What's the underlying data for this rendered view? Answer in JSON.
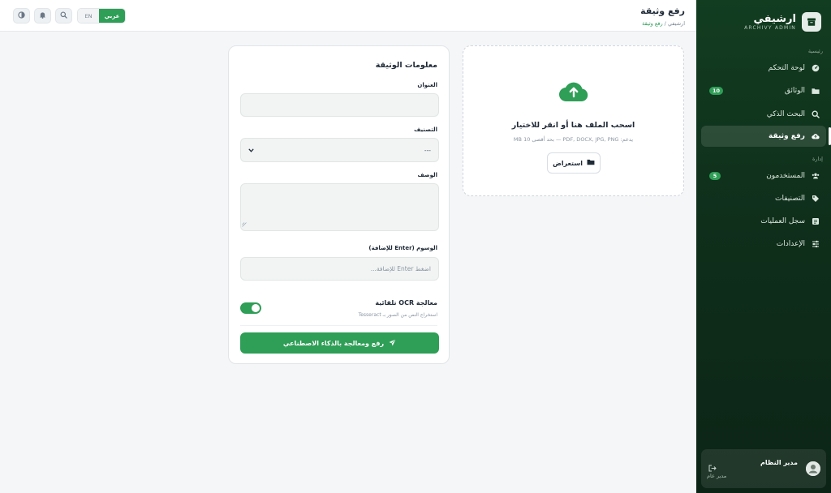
{
  "brand": {
    "name": "ارشيفي",
    "subtitle": "ARCHIVY ADMIN"
  },
  "sidebar": {
    "sections": [
      {
        "label": "رئيسية"
      },
      {
        "label": "إدارة"
      }
    ],
    "items": [
      {
        "label": "لوحة التحكم",
        "icon": "dashboard-icon"
      },
      {
        "label": "الوثائق",
        "icon": "folder-icon",
        "badge": "10"
      },
      {
        "label": "البحث الذكي",
        "icon": "search-icon"
      },
      {
        "label": "رفع وثيقة",
        "icon": "cloud-upload-icon",
        "active": true
      },
      {
        "label": "المستخدمون",
        "icon": "users-icon",
        "badge": "5"
      },
      {
        "label": "التصنيفات",
        "icon": "tags-icon"
      },
      {
        "label": "سجل العمليات",
        "icon": "history-icon"
      },
      {
        "label": "الإعدادات",
        "icon": "sliders-icon"
      }
    ]
  },
  "user": {
    "name": "مدير النظام",
    "role": "مدير عام"
  },
  "topbar": {
    "title": "رفع وثيقة",
    "breadcrumb_home": "ارشيفي",
    "breadcrumb_sep": " / ",
    "breadcrumb_current": "رفع وثيقة",
    "lang_en": "EN",
    "lang_ar": "عربي"
  },
  "upload": {
    "title": "اسحب الملف هنا أو انقر للاختيار",
    "hint": "يدعم: PDF, DOCX, JPG, PNG — بحد أقصى 10 MB",
    "browse_label": "استعراض"
  },
  "form": {
    "title": "معلومات الوثيقة",
    "title_label": "العنوان",
    "title_value": "",
    "category_label": "التصنيف",
    "category_value": "---",
    "description_label": "الوصف",
    "description_value": "",
    "tags_label": "الوسوم (Enter للإضافة)",
    "tags_placeholder": "اضغط Enter للإضافة...",
    "ocr_title": "معالجة OCR تلقائية",
    "ocr_desc": "استخراج النص من الصور بـ Tesseract",
    "ocr_enabled": true,
    "submit_label": "رفع ومعالجة بالذكاء الاصطناعي"
  },
  "colors": {
    "accent": "#2f9e57",
    "sidebar_bg": "#123d21"
  }
}
